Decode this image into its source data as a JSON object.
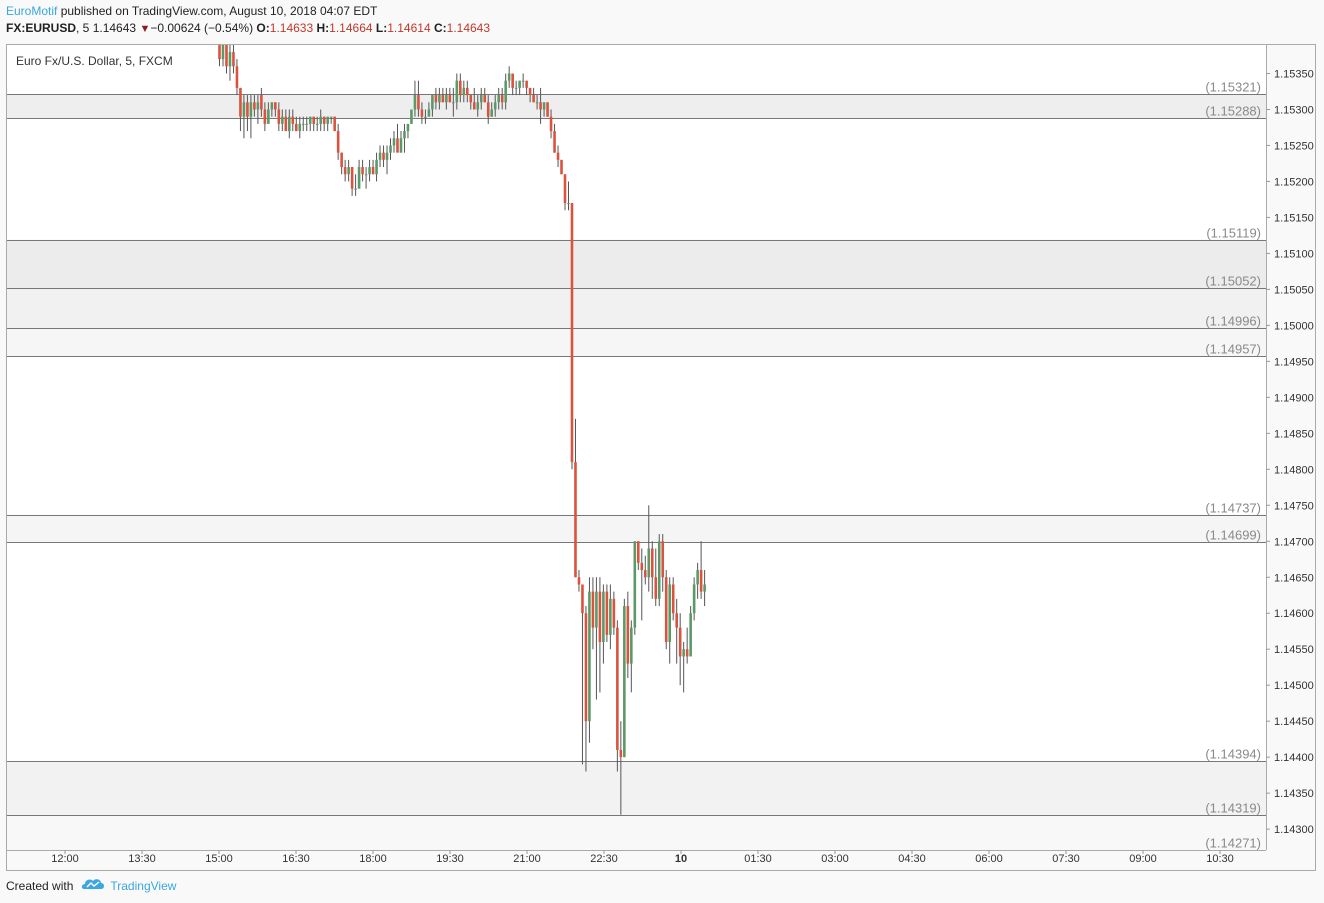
{
  "header": {
    "author": "EuroMotif",
    "published_text": " published on TradingView.com, August 10, 2018 04:07 EDT",
    "symbol": "FX:EURUSD",
    "interval": ", 5",
    "last": "1.14643",
    "arrow": "▼",
    "change": "−0.00624 (−0.54%)",
    "o_label": "O:",
    "o_value": "1.14633",
    "h_label": "H:",
    "h_value": "1.14664",
    "l_label": "L:",
    "l_value": "1.14614",
    "c_label": "C:",
    "c_value": "1.14643"
  },
  "chart_data": {
    "type": "candlestick",
    "title": "Euro Fx/U.S. Dollar, 5, FXCM",
    "interval_minutes": 5,
    "ylim": [
      1.14271,
      1.15391
    ],
    "y_ticks": [
      "1.15350",
      "1.15300",
      "1.15250",
      "1.15200",
      "1.15150",
      "1.15100",
      "1.15050",
      "1.15000",
      "1.14950",
      "1.14900",
      "1.14850",
      "1.14800",
      "1.14750",
      "1.14700",
      "1.14650",
      "1.14600",
      "1.14550",
      "1.14500",
      "1.14450",
      "1.14400",
      "1.14350",
      "1.14300"
    ],
    "x_ticks": [
      "12:00",
      "13:30",
      "15:00",
      "16:30",
      "18:00",
      "19:30",
      "21:00",
      "22:30",
      "10",
      "01:30",
      "03:00",
      "04:30",
      "06:00",
      "07:30",
      "09:00",
      "10:30"
    ],
    "x_tick_bold": [
      false,
      false,
      false,
      false,
      false,
      false,
      false,
      false,
      true,
      false,
      false,
      false,
      false,
      false,
      false,
      false
    ],
    "levels": [
      "1.15391",
      "1.15321",
      "1.15288",
      "1.15119",
      "1.15052",
      "1.14996",
      "1.14957",
      "1.14737",
      "1.14699",
      "1.14394",
      "1.14319",
      "1.14271"
    ],
    "zones": [
      {
        "from": "1.15288",
        "to": "1.15321",
        "color": "#eeeeee"
      },
      {
        "from": "1.15052",
        "to": "1.15119",
        "color": "#ececec"
      },
      {
        "from": "1.14996",
        "to": "1.15052",
        "color": "#f1f1f1"
      },
      {
        "from": "1.14957",
        "to": "1.14996",
        "color": "#f6f6f6"
      },
      {
        "from": "1.14699",
        "to": "1.14737",
        "color": "#f5f5f5"
      },
      {
        "from": "1.14319",
        "to": "1.14394",
        "color": "#f2f2f2"
      },
      {
        "from": "1.14271",
        "to": "1.14319",
        "color": "#f8f8f8"
      }
    ],
    "colors": {
      "up": "#5b9a68",
      "down": "#d9533f",
      "wick": "#555555",
      "level_line": "#777777",
      "level_text": "#8a8a8a"
    },
    "candles": [
      {
        "o": 1.1539,
        "h": 1.154,
        "l": 1.1536,
        "c": 1.1537
      },
      {
        "o": 1.1537,
        "h": 1.154,
        "l": 1.1536,
        "c": 1.1539
      },
      {
        "o": 1.1539,
        "h": 1.154,
        "l": 1.1535,
        "c": 1.1536
      },
      {
        "o": 1.1536,
        "h": 1.1539,
        "l": 1.1534,
        "c": 1.1538
      },
      {
        "o": 1.1538,
        "h": 1.1539,
        "l": 1.1535,
        "c": 1.1536
      },
      {
        "o": 1.1536,
        "h": 1.1537,
        "l": 1.1532,
        "c": 1.1533
      },
      {
        "o": 1.1533,
        "h": 1.1533,
        "l": 1.1527,
        "c": 1.1529
      },
      {
        "o": 1.1529,
        "h": 1.1532,
        "l": 1.1526,
        "c": 1.1531
      },
      {
        "o": 1.1531,
        "h": 1.1532,
        "l": 1.1527,
        "c": 1.1529
      },
      {
        "o": 1.1529,
        "h": 1.1532,
        "l": 1.1526,
        "c": 1.1531
      },
      {
        "o": 1.1531,
        "h": 1.1532,
        "l": 1.1529,
        "c": 1.153
      },
      {
        "o": 1.153,
        "h": 1.1532,
        "l": 1.1528,
        "c": 1.1531
      },
      {
        "o": 1.1532,
        "h": 1.1533,
        "l": 1.1529,
        "c": 1.153
      },
      {
        "o": 1.153,
        "h": 1.1531,
        "l": 1.1527,
        "c": 1.1528
      },
      {
        "o": 1.1528,
        "h": 1.1531,
        "l": 1.1528,
        "c": 1.153
      },
      {
        "o": 1.153,
        "h": 1.1531,
        "l": 1.1529,
        "c": 1.1531
      },
      {
        "o": 1.1531,
        "h": 1.1531,
        "l": 1.1529,
        "c": 1.153
      },
      {
        "o": 1.153,
        "h": 1.1531,
        "l": 1.1527,
        "c": 1.1528
      },
      {
        "o": 1.1528,
        "h": 1.153,
        "l": 1.1527,
        "c": 1.1529
      },
      {
        "o": 1.1529,
        "h": 1.153,
        "l": 1.1527,
        "c": 1.1527
      },
      {
        "o": 1.1527,
        "h": 1.153,
        "l": 1.1526,
        "c": 1.1529
      },
      {
        "o": 1.1529,
        "h": 1.153,
        "l": 1.1527,
        "c": 1.1528
      },
      {
        "o": 1.1528,
        "h": 1.1529,
        "l": 1.1527,
        "c": 1.1527
      },
      {
        "o": 1.1527,
        "h": 1.1529,
        "l": 1.1526,
        "c": 1.1528
      },
      {
        "o": 1.1528,
        "h": 1.1529,
        "l": 1.1527,
        "c": 1.1528
      },
      {
        "o": 1.1528,
        "h": 1.1529,
        "l": 1.1527,
        "c": 1.1528
      },
      {
        "o": 1.1528,
        "h": 1.1529,
        "l": 1.1527,
        "c": 1.1529
      },
      {
        "o": 1.1529,
        "h": 1.1529,
        "l": 1.1527,
        "c": 1.1528
      },
      {
        "o": 1.1528,
        "h": 1.1529,
        "l": 1.1527,
        "c": 1.1528
      },
      {
        "o": 1.1528,
        "h": 1.153,
        "l": 1.1527,
        "c": 1.1529
      },
      {
        "o": 1.1529,
        "h": 1.1529,
        "l": 1.1527,
        "c": 1.1528
      },
      {
        "o": 1.1528,
        "h": 1.1529,
        "l": 1.1527,
        "c": 1.1529
      },
      {
        "o": 1.1529,
        "h": 1.1529,
        "l": 1.1528,
        "c": 1.1529
      },
      {
        "o": 1.1529,
        "h": 1.1529,
        "l": 1.1527,
        "c": 1.1527
      },
      {
        "o": 1.1527,
        "h": 1.1528,
        "l": 1.1523,
        "c": 1.1524
      },
      {
        "o": 1.1524,
        "h": 1.1524,
        "l": 1.1521,
        "c": 1.1522
      },
      {
        "o": 1.1522,
        "h": 1.1523,
        "l": 1.152,
        "c": 1.1521
      },
      {
        "o": 1.1521,
        "h": 1.1523,
        "l": 1.152,
        "c": 1.1522
      },
      {
        "o": 1.1522,
        "h": 1.1522,
        "l": 1.1518,
        "c": 1.1519
      },
      {
        "o": 1.1519,
        "h": 1.1521,
        "l": 1.1518,
        "c": 1.1519
      },
      {
        "o": 1.1519,
        "h": 1.1523,
        "l": 1.1519,
        "c": 1.1522
      },
      {
        "o": 1.1522,
        "h": 1.1523,
        "l": 1.152,
        "c": 1.1521
      },
      {
        "o": 1.1521,
        "h": 1.1522,
        "l": 1.1519,
        "c": 1.1521
      },
      {
        "o": 1.1521,
        "h": 1.1523,
        "l": 1.152,
        "c": 1.1522
      },
      {
        "o": 1.1522,
        "h": 1.1523,
        "l": 1.1521,
        "c": 1.1521
      },
      {
        "o": 1.1521,
        "h": 1.1524,
        "l": 1.152,
        "c": 1.1523
      },
      {
        "o": 1.1523,
        "h": 1.1525,
        "l": 1.1522,
        "c": 1.1524
      },
      {
        "o": 1.1524,
        "h": 1.1525,
        "l": 1.1522,
        "c": 1.1523
      },
      {
        "o": 1.1523,
        "h": 1.1525,
        "l": 1.1521,
        "c": 1.1524
      },
      {
        "o": 1.1524,
        "h": 1.1526,
        "l": 1.1523,
        "c": 1.1525
      },
      {
        "o": 1.1525,
        "h": 1.1527,
        "l": 1.1524,
        "c": 1.1526
      },
      {
        "o": 1.1526,
        "h": 1.1528,
        "l": 1.1525,
        "c": 1.1524
      },
      {
        "o": 1.1524,
        "h": 1.1527,
        "l": 1.1524,
        "c": 1.1526
      },
      {
        "o": 1.1526,
        "h": 1.1528,
        "l": 1.1524,
        "c": 1.1527
      },
      {
        "o": 1.1527,
        "h": 1.1528,
        "l": 1.1526,
        "c": 1.1528
      },
      {
        "o": 1.1528,
        "h": 1.153,
        "l": 1.1528,
        "c": 1.153
      },
      {
        "o": 1.153,
        "h": 1.1534,
        "l": 1.1529,
        "c": 1.1532
      },
      {
        "o": 1.1532,
        "h": 1.1534,
        "l": 1.1529,
        "c": 1.153
      },
      {
        "o": 1.153,
        "h": 1.1531,
        "l": 1.1528,
        "c": 1.1529
      },
      {
        "o": 1.1529,
        "h": 1.153,
        "l": 1.1528,
        "c": 1.1529
      },
      {
        "o": 1.1529,
        "h": 1.1531,
        "l": 1.1529,
        "c": 1.153
      },
      {
        "o": 1.153,
        "h": 1.1532,
        "l": 1.1529,
        "c": 1.1532
      },
      {
        "o": 1.1532,
        "h": 1.1533,
        "l": 1.153,
        "c": 1.1531
      },
      {
        "o": 1.1531,
        "h": 1.1533,
        "l": 1.153,
        "c": 1.1532
      },
      {
        "o": 1.1532,
        "h": 1.1533,
        "l": 1.1531,
        "c": 1.1531
      },
      {
        "o": 1.1531,
        "h": 1.1533,
        "l": 1.153,
        "c": 1.1532
      },
      {
        "o": 1.1532,
        "h": 1.1533,
        "l": 1.1531,
        "c": 1.1531
      },
      {
        "o": 1.1531,
        "h": 1.1533,
        "l": 1.1529,
        "c": 1.1531
      },
      {
        "o": 1.1531,
        "h": 1.1535,
        "l": 1.153,
        "c": 1.1534
      },
      {
        "o": 1.1534,
        "h": 1.1535,
        "l": 1.1531,
        "c": 1.1532
      },
      {
        "o": 1.1532,
        "h": 1.1534,
        "l": 1.1531,
        "c": 1.1533
      },
      {
        "o": 1.1533,
        "h": 1.1534,
        "l": 1.1531,
        "c": 1.1532
      },
      {
        "o": 1.1532,
        "h": 1.1532,
        "l": 1.153,
        "c": 1.1531
      },
      {
        "o": 1.1531,
        "h": 1.1533,
        "l": 1.153,
        "c": 1.153
      },
      {
        "o": 1.153,
        "h": 1.1532,
        "l": 1.1529,
        "c": 1.1531
      },
      {
        "o": 1.1531,
        "h": 1.1533,
        "l": 1.153,
        "c": 1.1532
      },
      {
        "o": 1.1532,
        "h": 1.1533,
        "l": 1.1531,
        "c": 1.1531
      },
      {
        "o": 1.1531,
        "h": 1.1532,
        "l": 1.1528,
        "c": 1.1529
      },
      {
        "o": 1.1529,
        "h": 1.1531,
        "l": 1.1529,
        "c": 1.153
      },
      {
        "o": 1.153,
        "h": 1.1532,
        "l": 1.1529,
        "c": 1.1531
      },
      {
        "o": 1.1531,
        "h": 1.1533,
        "l": 1.153,
        "c": 1.1532
      },
      {
        "o": 1.1532,
        "h": 1.1533,
        "l": 1.153,
        "c": 1.1531
      },
      {
        "o": 1.1531,
        "h": 1.1535,
        "l": 1.153,
        "c": 1.1534
      },
      {
        "o": 1.1534,
        "h": 1.1536,
        "l": 1.1533,
        "c": 1.1535
      },
      {
        "o": 1.1535,
        "h": 1.1535,
        "l": 1.1532,
        "c": 1.1533
      },
      {
        "o": 1.1533,
        "h": 1.1534,
        "l": 1.1532,
        "c": 1.1533
      },
      {
        "o": 1.1533,
        "h": 1.1534,
        "l": 1.1532,
        "c": 1.1534
      },
      {
        "o": 1.1534,
        "h": 1.1535,
        "l": 1.1533,
        "c": 1.1534
      },
      {
        "o": 1.1534,
        "h": 1.1534,
        "l": 1.1532,
        "c": 1.1533
      },
      {
        "o": 1.1533,
        "h": 1.1533,
        "l": 1.1531,
        "c": 1.1532
      },
      {
        "o": 1.1532,
        "h": 1.1533,
        "l": 1.1531,
        "c": 1.1531
      },
      {
        "o": 1.1531,
        "h": 1.1532,
        "l": 1.153,
        "c": 1.1531
      },
      {
        "o": 1.1531,
        "h": 1.1533,
        "l": 1.1528,
        "c": 1.153
      },
      {
        "o": 1.153,
        "h": 1.1531,
        "l": 1.1529,
        "c": 1.1531
      },
      {
        "o": 1.1531,
        "h": 1.1531,
        "l": 1.1529,
        "c": 1.1529
      },
      {
        "o": 1.1529,
        "h": 1.153,
        "l": 1.1526,
        "c": 1.1527
      },
      {
        "o": 1.1527,
        "h": 1.1528,
        "l": 1.1524,
        "c": 1.1524
      },
      {
        "o": 1.1524,
        "h": 1.1525,
        "l": 1.1522,
        "c": 1.1523
      },
      {
        "o": 1.1523,
        "h": 1.1523,
        "l": 1.1521,
        "c": 1.1521
      },
      {
        "o": 1.1521,
        "h": 1.1521,
        "l": 1.1516,
        "c": 1.1517
      },
      {
        "o": 1.1517,
        "h": 1.152,
        "l": 1.1516,
        "c": 1.1517
      },
      {
        "o": 1.1517,
        "h": 1.1517,
        "l": 1.148,
        "c": 1.1481
      },
      {
        "o": 1.1481,
        "h": 1.1487,
        "l": 1.1465,
        "c": 1.1465
      },
      {
        "o": 1.1465,
        "h": 1.1466,
        "l": 1.1463,
        "c": 1.1464
      },
      {
        "o": 1.1464,
        "h": 1.1464,
        "l": 1.1439,
        "c": 1.146
      },
      {
        "o": 1.146,
        "h": 1.1461,
        "l": 1.1438,
        "c": 1.1445
      },
      {
        "o": 1.1445,
        "h": 1.1465,
        "l": 1.1442,
        "c": 1.1463
      },
      {
        "o": 1.1463,
        "h": 1.1465,
        "l": 1.1455,
        "c": 1.1458
      },
      {
        "o": 1.1458,
        "h": 1.1465,
        "l": 1.1448,
        "c": 1.1463
      },
      {
        "o": 1.1463,
        "h": 1.1465,
        "l": 1.1449,
        "c": 1.1456
      },
      {
        "o": 1.1456,
        "h": 1.1464,
        "l": 1.1453,
        "c": 1.1463
      },
      {
        "o": 1.1463,
        "h": 1.1464,
        "l": 1.1456,
        "c": 1.1457
      },
      {
        "o": 1.1457,
        "h": 1.1464,
        "l": 1.1455,
        "c": 1.1462
      },
      {
        "o": 1.1462,
        "h": 1.1463,
        "l": 1.1457,
        "c": 1.1458
      },
      {
        "o": 1.1458,
        "h": 1.1459,
        "l": 1.1438,
        "c": 1.1441
      },
      {
        "o": 1.1441,
        "h": 1.1445,
        "l": 1.1432,
        "c": 1.144
      },
      {
        "o": 1.144,
        "h": 1.1462,
        "l": 1.144,
        "c": 1.1461
      },
      {
        "o": 1.1461,
        "h": 1.1463,
        "l": 1.1451,
        "c": 1.1453
      },
      {
        "o": 1.1453,
        "h": 1.1459,
        "l": 1.1449,
        "c": 1.1458
      },
      {
        "o": 1.1458,
        "h": 1.147,
        "l": 1.1457,
        "c": 1.147
      },
      {
        "o": 1.147,
        "h": 1.147,
        "l": 1.1466,
        "c": 1.1467
      },
      {
        "o": 1.1467,
        "h": 1.1469,
        "l": 1.1459,
        "c": 1.1466
      },
      {
        "o": 1.1466,
        "h": 1.1468,
        "l": 1.1464,
        "c": 1.1465
      },
      {
        "o": 1.1465,
        "h": 1.1475,
        "l": 1.1463,
        "c": 1.1469
      },
      {
        "o": 1.1469,
        "h": 1.147,
        "l": 1.1462,
        "c": 1.1465
      },
      {
        "o": 1.1465,
        "h": 1.1469,
        "l": 1.1461,
        "c": 1.1462
      },
      {
        "o": 1.1462,
        "h": 1.1471,
        "l": 1.1461,
        "c": 1.147
      },
      {
        "o": 1.147,
        "h": 1.1471,
        "l": 1.1463,
        "c": 1.1465
      },
      {
        "o": 1.1465,
        "h": 1.1466,
        "l": 1.1455,
        "c": 1.1456
      },
      {
        "o": 1.1456,
        "h": 1.1465,
        "l": 1.1453,
        "c": 1.1464
      },
      {
        "o": 1.1464,
        "h": 1.1465,
        "l": 1.1459,
        "c": 1.146
      },
      {
        "o": 1.146,
        "h": 1.1462,
        "l": 1.1453,
        "c": 1.1458
      },
      {
        "o": 1.1458,
        "h": 1.146,
        "l": 1.145,
        "c": 1.1454
      },
      {
        "o": 1.1454,
        "h": 1.1456,
        "l": 1.1449,
        "c": 1.1455
      },
      {
        "o": 1.1455,
        "h": 1.1458,
        "l": 1.1453,
        "c": 1.1454
      },
      {
        "o": 1.1454,
        "h": 1.1461,
        "l": 1.1454,
        "c": 1.146
      },
      {
        "o": 1.146,
        "h": 1.1465,
        "l": 1.1459,
        "c": 1.1464
      },
      {
        "o": 1.1464,
        "h": 1.1467,
        "l": 1.1462,
        "c": 1.1466
      },
      {
        "o": 1.1466,
        "h": 1.147,
        "l": 1.1462,
        "c": 1.1463
      },
      {
        "o": 1.1463,
        "h": 1.1466,
        "l": 1.1461,
        "c": 1.1464
      }
    ]
  },
  "footer": {
    "created_with": "Created with",
    "brand": "TradingView"
  }
}
